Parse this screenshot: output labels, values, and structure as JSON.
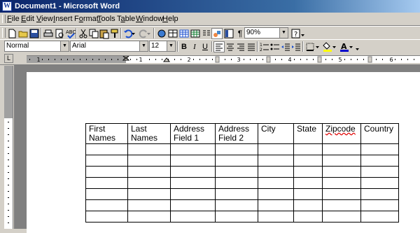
{
  "window": {
    "title": "Document1 - Microsoft Word",
    "app_icon": "W"
  },
  "menu": [
    {
      "label": "File",
      "accel": "F",
      "rest": "ile"
    },
    {
      "label": "Edit",
      "accel": "E",
      "rest": "dit"
    },
    {
      "label": "View",
      "accel": "V",
      "rest": "iew"
    },
    {
      "label": "Insert",
      "accel": "I",
      "rest": "nsert"
    },
    {
      "label": "Format",
      "pre": "F",
      "accel": "o",
      "rest": "rmat"
    },
    {
      "label": "Tools",
      "accel": "T",
      "rest": "ools"
    },
    {
      "label": "Table",
      "pre": "T",
      "accel": "a",
      "rest": "ble"
    },
    {
      "label": "Window",
      "accel": "W",
      "rest": "indow"
    },
    {
      "label": "Help",
      "accel": "H",
      "rest": "elp"
    }
  ],
  "standard_toolbar": {
    "zoom": "90%"
  },
  "formatting_toolbar": {
    "style": "Normal",
    "font": "Arial",
    "size": "12",
    "bold": "B",
    "italic": "I",
    "underline": "U",
    "highlight_color": "#ffff00",
    "font_color": "#0000cc"
  },
  "ruler": {
    "tab_selector": "L",
    "numbers": [
      "1",
      "1",
      "2",
      "3",
      "4",
      "5",
      "6"
    ]
  },
  "table": {
    "headers": [
      {
        "line1": "First",
        "line2": "Names"
      },
      {
        "line1": "Last",
        "line2": "Names"
      },
      {
        "line1": "Address",
        "line2": "Field 1"
      },
      {
        "line1": "Address",
        "line2": "Field 2"
      },
      {
        "line1": "City",
        "line2": ""
      },
      {
        "line1": "State",
        "line2": ""
      },
      {
        "line1": "Zipcode",
        "line2": ""
      },
      {
        "line1": "Country",
        "line2": ""
      }
    ],
    "empty_rows": 7
  }
}
